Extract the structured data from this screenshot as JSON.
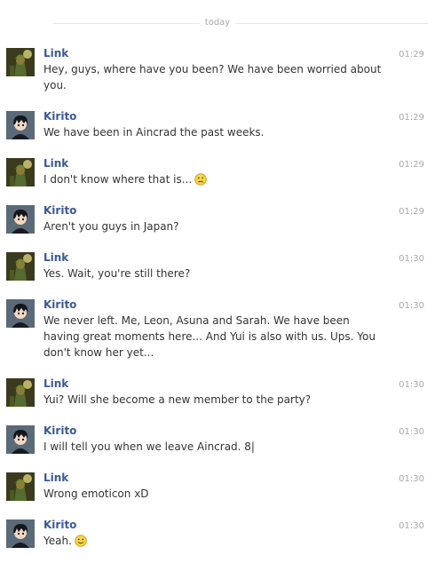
{
  "date_divider": "today",
  "messages": [
    {
      "sender": "Link",
      "text": "Hey, guys, where have you been? We have been worried about you.",
      "time": "01:29",
      "avatar": "link-avatar",
      "emoticon": ""
    },
    {
      "sender": "Kirito",
      "text": "We have been in Aincrad the past weeks.",
      "time": "01:29",
      "avatar": "kirito-avatar",
      "emoticon": ""
    },
    {
      "sender": "Link",
      "text": "I don't know where that is...",
      "time": "01:29",
      "avatar": "link-avatar",
      "emoticon": "frown"
    },
    {
      "sender": "Kirito",
      "text": "Aren't you guys in Japan?",
      "time": "01:29",
      "avatar": "kirito-avatar",
      "emoticon": ""
    },
    {
      "sender": "Link",
      "text": "Yes. Wait, you're still there?",
      "time": "01:30",
      "avatar": "link-avatar",
      "emoticon": ""
    },
    {
      "sender": "Kirito",
      "text": "We never left. Me, Leon, Asuna and Sarah. We have been having great moments here... And Yui is also with us. Ups. You don't know her yet...",
      "time": "01:30",
      "avatar": "kirito-avatar",
      "emoticon": ""
    },
    {
      "sender": "Link",
      "text": "Yui? Will she become a new member to the party?",
      "time": "01:30",
      "avatar": "link-avatar",
      "emoticon": ""
    },
    {
      "sender": "Kirito",
      "text": "I will tell you when we leave Aincrad. 8|",
      "time": "01:30",
      "avatar": "kirito-avatar",
      "emoticon": ""
    },
    {
      "sender": "Link",
      "text": "Wrong emoticon xD",
      "time": "01:30",
      "avatar": "link-avatar",
      "emoticon": ""
    },
    {
      "sender": "Kirito",
      "text": "Yeah.",
      "time": "01:30",
      "avatar": "kirito-avatar",
      "emoticon": "smile"
    }
  ]
}
